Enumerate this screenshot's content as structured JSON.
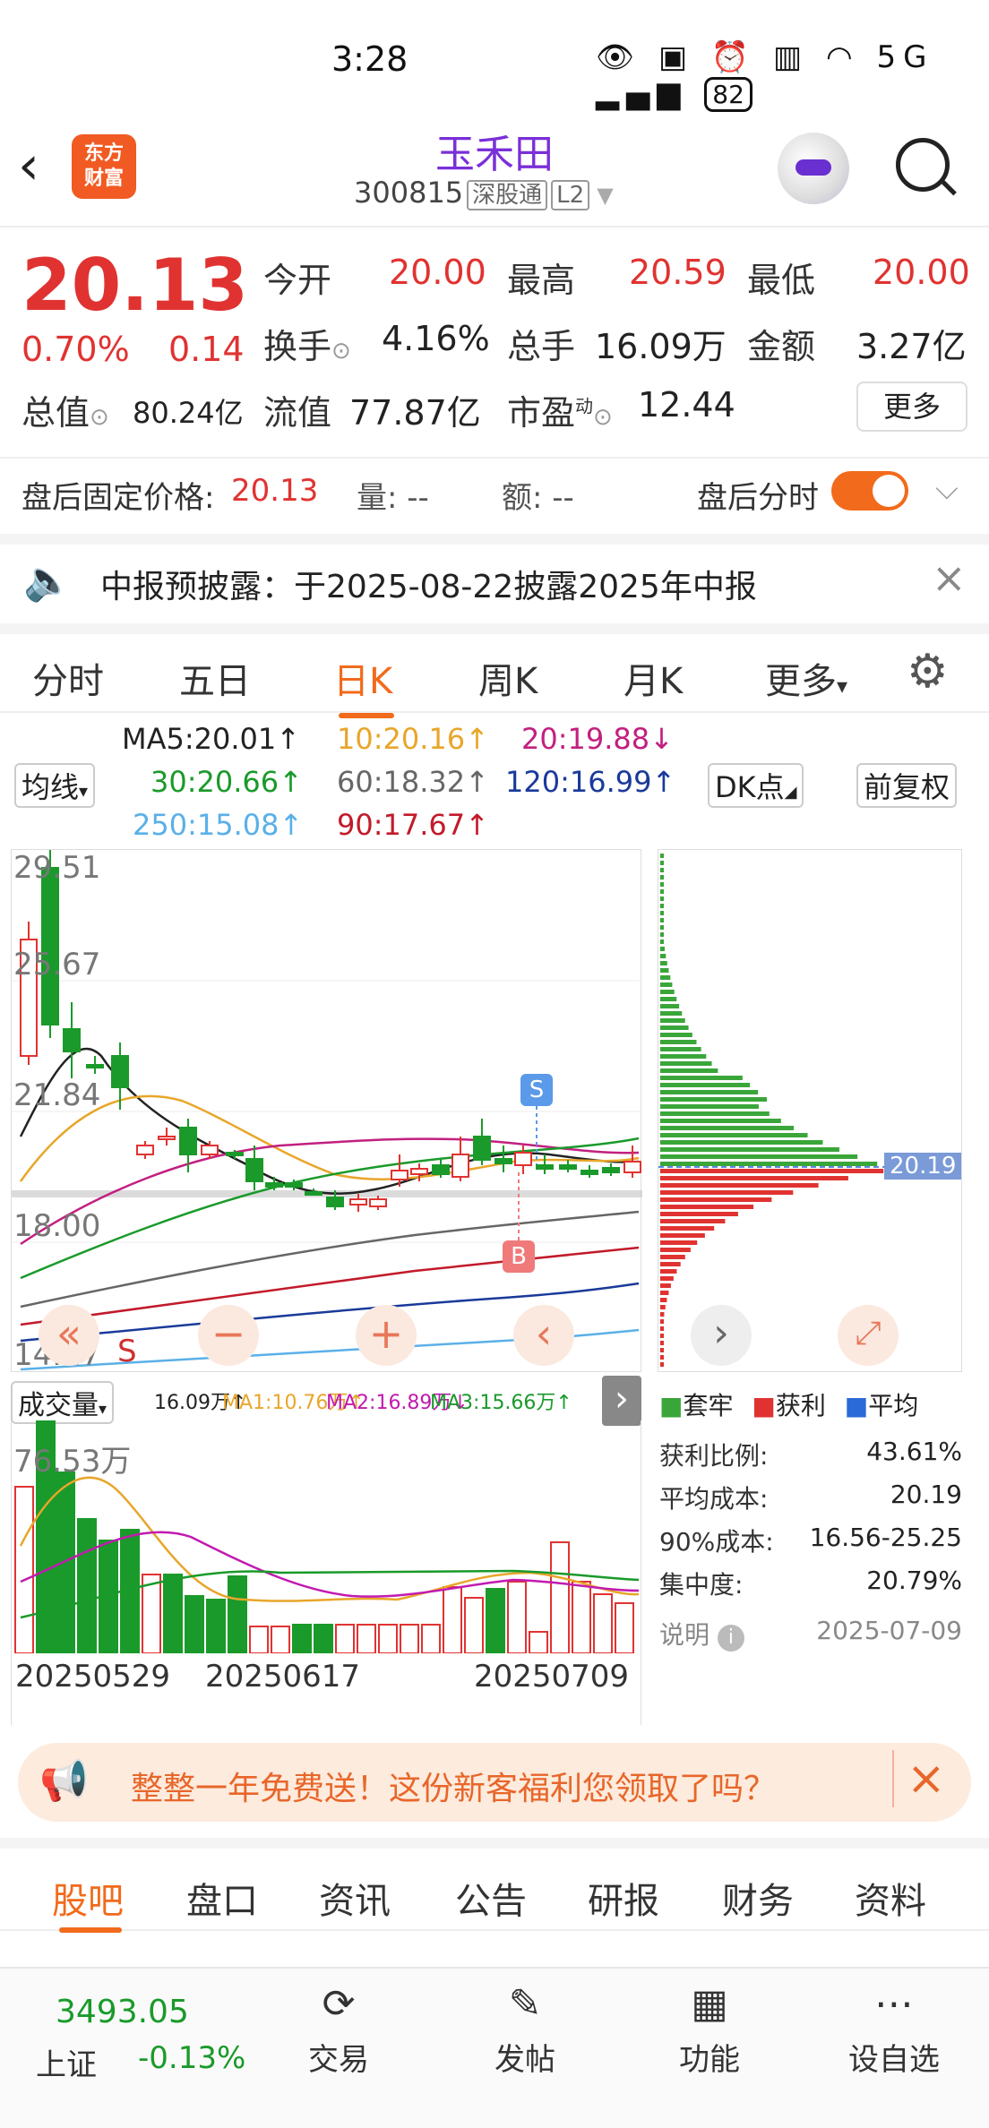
{
  "status": {
    "time": "3:28",
    "battery": "82",
    "signal": "5G"
  },
  "header": {
    "stock_name": "玉禾田",
    "code": "300815",
    "tag1": "深股通",
    "tag2": "L2"
  },
  "quote": {
    "price": "20.13",
    "pct": "0.70%",
    "change": "0.14",
    "open_label": "今开",
    "open": "20.00",
    "high_label": "最高",
    "high": "20.59",
    "low_label": "最低",
    "low": "20.00",
    "turnover_label": "换手",
    "turnover": "4.16%",
    "vol_label": "总手",
    "vol": "16.09万",
    "amt_label": "金额",
    "amt": "3.27亿",
    "mcap_label": "总值",
    "mcap": "80.24亿",
    "float_label": "流值",
    "float": "77.87亿",
    "pe_label": "市盈",
    "pe_sup": "动",
    "pe": "12.44",
    "more": "更多"
  },
  "after_hours": {
    "label": "盘后固定价格:",
    "price": "20.13",
    "vol_label": "量:",
    "vol": "--",
    "amt_label": "额:",
    "amt": "--",
    "toggle_label": "盘后分时"
  },
  "notice": {
    "text": "中报预披露：于2025-08-22披露2025年中报"
  },
  "tabs": [
    "分时",
    "五日",
    "日K",
    "周K",
    "月K",
    "更多"
  ],
  "ma": {
    "select": "均线",
    "ma5": "MA5:20.01↑",
    "ma10": "10:20.16↑",
    "ma20": "20:19.88↓",
    "ma30": "30:20.66↑",
    "ma60": "60:18.32↑",
    "ma120": "120:16.99↑",
    "ma250": "250:15.08↑",
    "ma90": "90:17.67↑",
    "dk": "DK点",
    "fq": "前复权"
  },
  "kline": {
    "y_labels": [
      "29.51",
      "25.67",
      "21.84",
      "18.00",
      "14.17"
    ],
    "marker_s": "S",
    "marker_b": "B",
    "marker_s2": "S",
    "price_line": "20.19"
  },
  "volume": {
    "select": "成交量",
    "v": "16.09万↑",
    "ma1": "MA1:10.76万↑",
    "ma2": "MA2:16.89万↓",
    "ma3": "MA3:15.66万↑",
    "y_max": "76.53万",
    "dates": [
      "20250529",
      "20250617",
      "20250709"
    ]
  },
  "chips": {
    "legend": [
      "套牢",
      "获利",
      "平均"
    ],
    "rows": [
      {
        "k": "获利比例:",
        "v": "43.61%"
      },
      {
        "k": "平均成本:",
        "v": "20.19"
      },
      {
        "k": "90%成本:",
        "v": "16.56-25.25"
      },
      {
        "k": "集中度:",
        "v": "20.79%"
      }
    ],
    "note_label": "说明",
    "date": "2025-07-09"
  },
  "promo": {
    "text": "整整一年免费送！这份新客福利您领取了吗？"
  },
  "bottom_tabs": [
    "股吧",
    "盘口",
    "资讯",
    "公告",
    "研报",
    "财务",
    "资料"
  ],
  "nav": {
    "index_value": "3493.05",
    "index_name": "上证",
    "index_pct": "-0.13%",
    "items": [
      "交易",
      "发帖",
      "功能",
      "设自选"
    ]
  },
  "colors": {
    "red": "#e03331",
    "green": "#1a9a2a",
    "orange": "#f26a1b"
  }
}
